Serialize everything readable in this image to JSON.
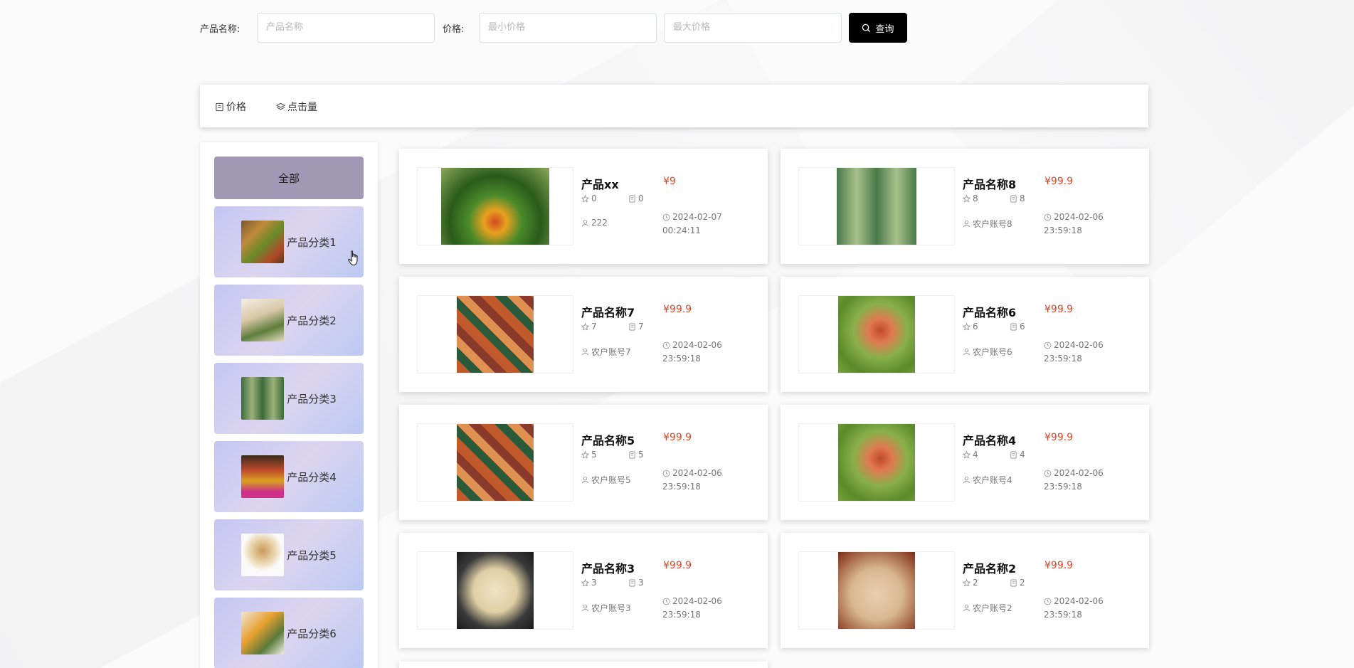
{
  "search": {
    "name_label": "产品名称:",
    "name_placeholder": "产品名称",
    "price_label": "价格:",
    "min_placeholder": "最小价格",
    "max_placeholder": "最大价格",
    "query_label": "查询"
  },
  "sort": {
    "price_label": "价格",
    "clicks_label": "点击量"
  },
  "categories": {
    "all_label": "全部",
    "items": [
      {
        "label": "产品分类1"
      },
      {
        "label": "产品分类2"
      },
      {
        "label": "产品分类3"
      },
      {
        "label": "产品分类4"
      },
      {
        "label": "产品分类5"
      },
      {
        "label": "产品分类6"
      }
    ]
  },
  "products": [
    {
      "title": "产品xx",
      "price": "¥9",
      "stars": "0",
      "comments": "0",
      "user": "222",
      "date": "2024-02-07",
      "time": "00:24:11"
    },
    {
      "title": "产品名称8",
      "price": "¥99.9",
      "stars": "8",
      "comments": "8",
      "user": "农户账号8",
      "date": "2024-02-06",
      "time": "23:59:18"
    },
    {
      "title": "产品名称7",
      "price": "¥99.9",
      "stars": "7",
      "comments": "7",
      "user": "农户账号7",
      "date": "2024-02-06",
      "time": "23:59:18"
    },
    {
      "title": "产品名称6",
      "price": "¥99.9",
      "stars": "6",
      "comments": "6",
      "user": "农户账号6",
      "date": "2024-02-06",
      "time": "23:59:18"
    },
    {
      "title": "产品名称5",
      "price": "¥99.9",
      "stars": "5",
      "comments": "5",
      "user": "农户账号5",
      "date": "2024-02-06",
      "time": "23:59:18"
    },
    {
      "title": "产品名称4",
      "price": "¥99.9",
      "stars": "4",
      "comments": "4",
      "user": "农户账号4",
      "date": "2024-02-06",
      "time": "23:59:18"
    },
    {
      "title": "产品名称3",
      "price": "¥99.9",
      "stars": "3",
      "comments": "3",
      "user": "农户账号3",
      "date": "2024-02-06",
      "time": "23:59:18"
    },
    {
      "title": "产品名称2",
      "price": "¥99.9",
      "stars": "2",
      "comments": "2",
      "user": "农户账号2",
      "date": "2024-02-06",
      "time": "23:59:18"
    }
  ],
  "icons": {
    "search": "search-icon",
    "price_sort": "receipt-icon",
    "clicks_sort": "layers-icon",
    "star": "star-icon",
    "comment": "document-icon",
    "user": "user-icon",
    "clock": "clock-icon"
  },
  "colors": {
    "price": "#e0462a",
    "query_button": "#000000",
    "all_category": "#a198b5"
  }
}
